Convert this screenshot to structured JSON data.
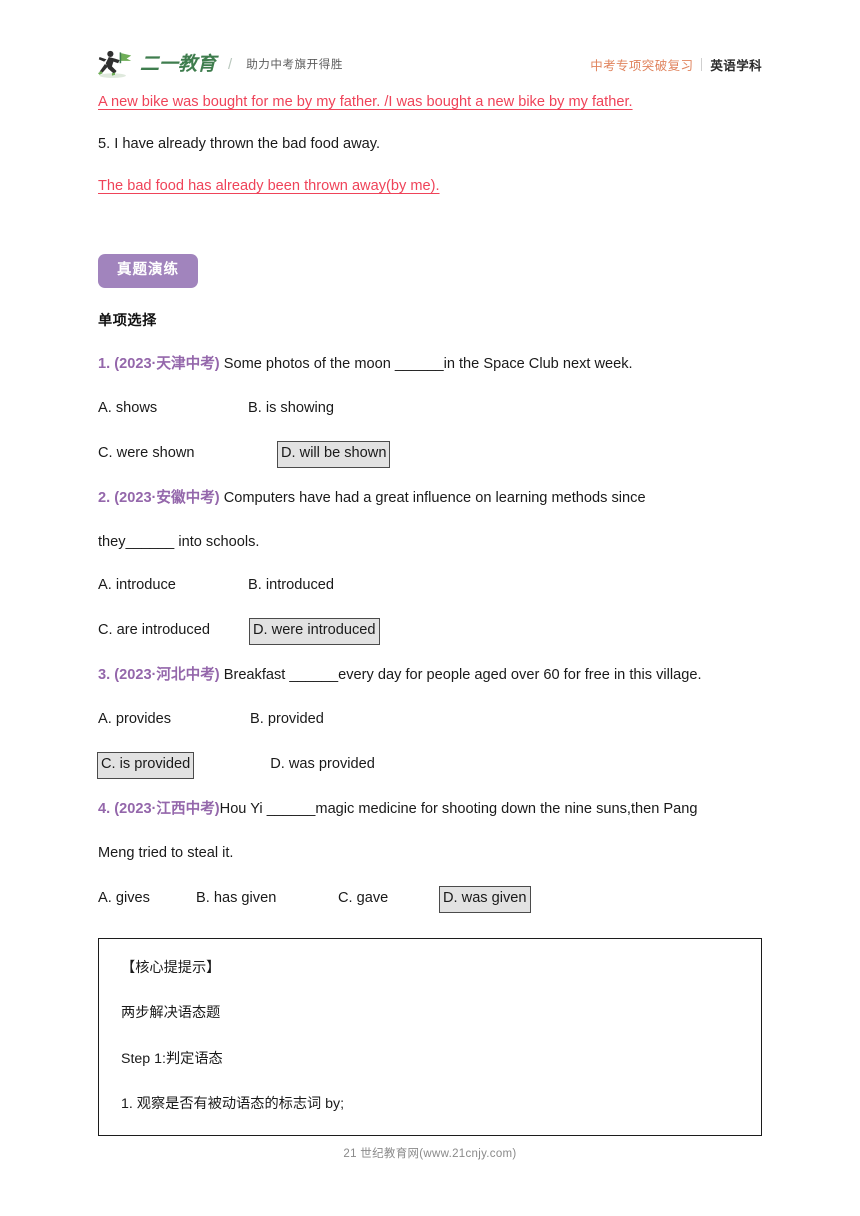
{
  "header": {
    "logo_icon": "running-figure-flag-icon",
    "brand_name": "二一教育",
    "brand_divider": "/",
    "brand_tagline": "助力中考旗开得胜",
    "course_label": "中考专项突破复习",
    "subject_label": "英语学科",
    "course_color": "#e0845e",
    "brand_color": "#3f7d4e"
  },
  "top_answers": {
    "answer_1": "A new bike was bought for me by my father. /I was bought a new bike by my father.",
    "item_5": "5. I have already thrown the bad food away.",
    "answer_5": "The bad food has already been thrown away(by me).",
    "answer_color": "#ef4359"
  },
  "practice": {
    "badge_label": "真题演练",
    "badge_color": "#a184bd",
    "section_title": "单项选择",
    "source_color": "#9467ab",
    "questions": [
      {
        "number": "1.",
        "source": "(2023·天津中考)",
        "stem": "Some photos of the moon ______in the Space Club next week.",
        "stem_cont": "",
        "rows": [
          [
            {
              "text": "A. shows",
              "selected": false
            },
            {
              "text": "B. is showing",
              "selected": false
            }
          ],
          [
            {
              "text": "C. were shown",
              "selected": false
            },
            {
              "text": "D. will be shown",
              "selected": true
            }
          ]
        ]
      },
      {
        "number": "2.",
        "source": "(2023·安徽中考)",
        "stem": "Computers have had a great influence on learning methods since",
        "stem_cont": "they______ into schools.",
        "rows": [
          [
            {
              "text": "A. introduce",
              "selected": false
            },
            {
              "text": "B. introduced",
              "selected": false
            }
          ],
          [
            {
              "text": "C. are introduced",
              "selected": false
            },
            {
              "text": "D. were introduced",
              "selected": true
            }
          ]
        ]
      },
      {
        "number": "3.",
        "source": "(2023·河北中考)",
        "stem": "Breakfast ______every day for people aged over 60 for free in this village.",
        "stem_cont": "",
        "rows": [
          [
            {
              "text": "A. provides",
              "selected": false
            },
            {
              "text": "B. provided",
              "selected": false
            }
          ],
          [
            {
              "text": "C. is provided",
              "selected": true
            },
            {
              "text": "D. was provided",
              "selected": false
            }
          ]
        ]
      },
      {
        "number": "4.",
        "source": "(2023·江西中考)",
        "stem": "Hou Yi ______magic medicine for shooting down the nine suns,then Pang",
        "stem_cont": "Meng tried to steal it.",
        "rows": [
          [
            {
              "text": "A. gives",
              "selected": false
            },
            {
              "text": "B. has given",
              "selected": false
            },
            {
              "text": "C. gave",
              "selected": false
            },
            {
              "text": "D. was given",
              "selected": true
            }
          ]
        ]
      }
    ]
  },
  "tip_box": {
    "title": "【核心提提示】",
    "subtitle": "两步解决语态题",
    "step": "Step 1:判定语态",
    "point": "1. 观察是否有被动语态的标志词 by;"
  },
  "footer": {
    "text": "21 世纪教育网(www.21cnjy.com)"
  }
}
